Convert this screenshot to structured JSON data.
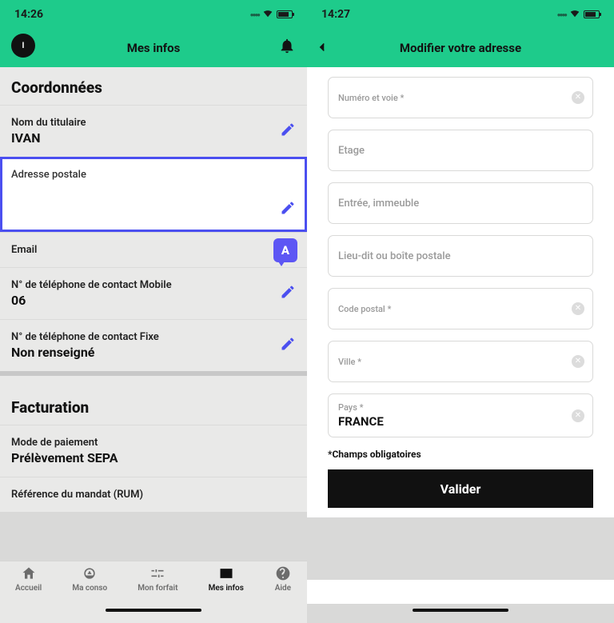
{
  "left": {
    "statusbar": {
      "time": "14:26"
    },
    "header": {
      "title": "Mes infos",
      "avatar_initial": "I"
    },
    "section1_title": "Coordonnées",
    "rows": {
      "name": {
        "label": "Nom du titulaire",
        "value": "IVAN"
      },
      "address": {
        "label": "Adresse postale"
      },
      "email": {
        "label": "Email",
        "badge": "A"
      },
      "mobile": {
        "label": "N° de téléphone de contact Mobile",
        "value": "06"
      },
      "fixed": {
        "label": "N° de téléphone de contact Fixe",
        "value": "Non renseigné"
      }
    },
    "section2_title": "Facturation",
    "billing": {
      "pay_mode": {
        "label": "Mode de paiement",
        "value": "Prélèvement SEPA"
      },
      "rum": {
        "label": "Référence du mandat (RUM)"
      }
    },
    "tabs": {
      "accueil": "Accueil",
      "conso": "Ma conso",
      "forfait": "Mon forfait",
      "infos": "Mes infos",
      "aide": "Aide"
    }
  },
  "right": {
    "statusbar": {
      "time": "14:27"
    },
    "header": {
      "title": "Modifier votre adresse"
    },
    "fields": {
      "numvoie": "Numéro et voie *",
      "etage": "Etage",
      "entree": "Entrée, immeuble",
      "lieudit": "Lieu-dit ou boîte postale",
      "cp": "Code postal *",
      "ville": "Ville *",
      "pays": {
        "label": "Pays *",
        "value": "FRANCE"
      }
    },
    "required_note": "*Champs obligatoires",
    "validate": "Valider"
  }
}
